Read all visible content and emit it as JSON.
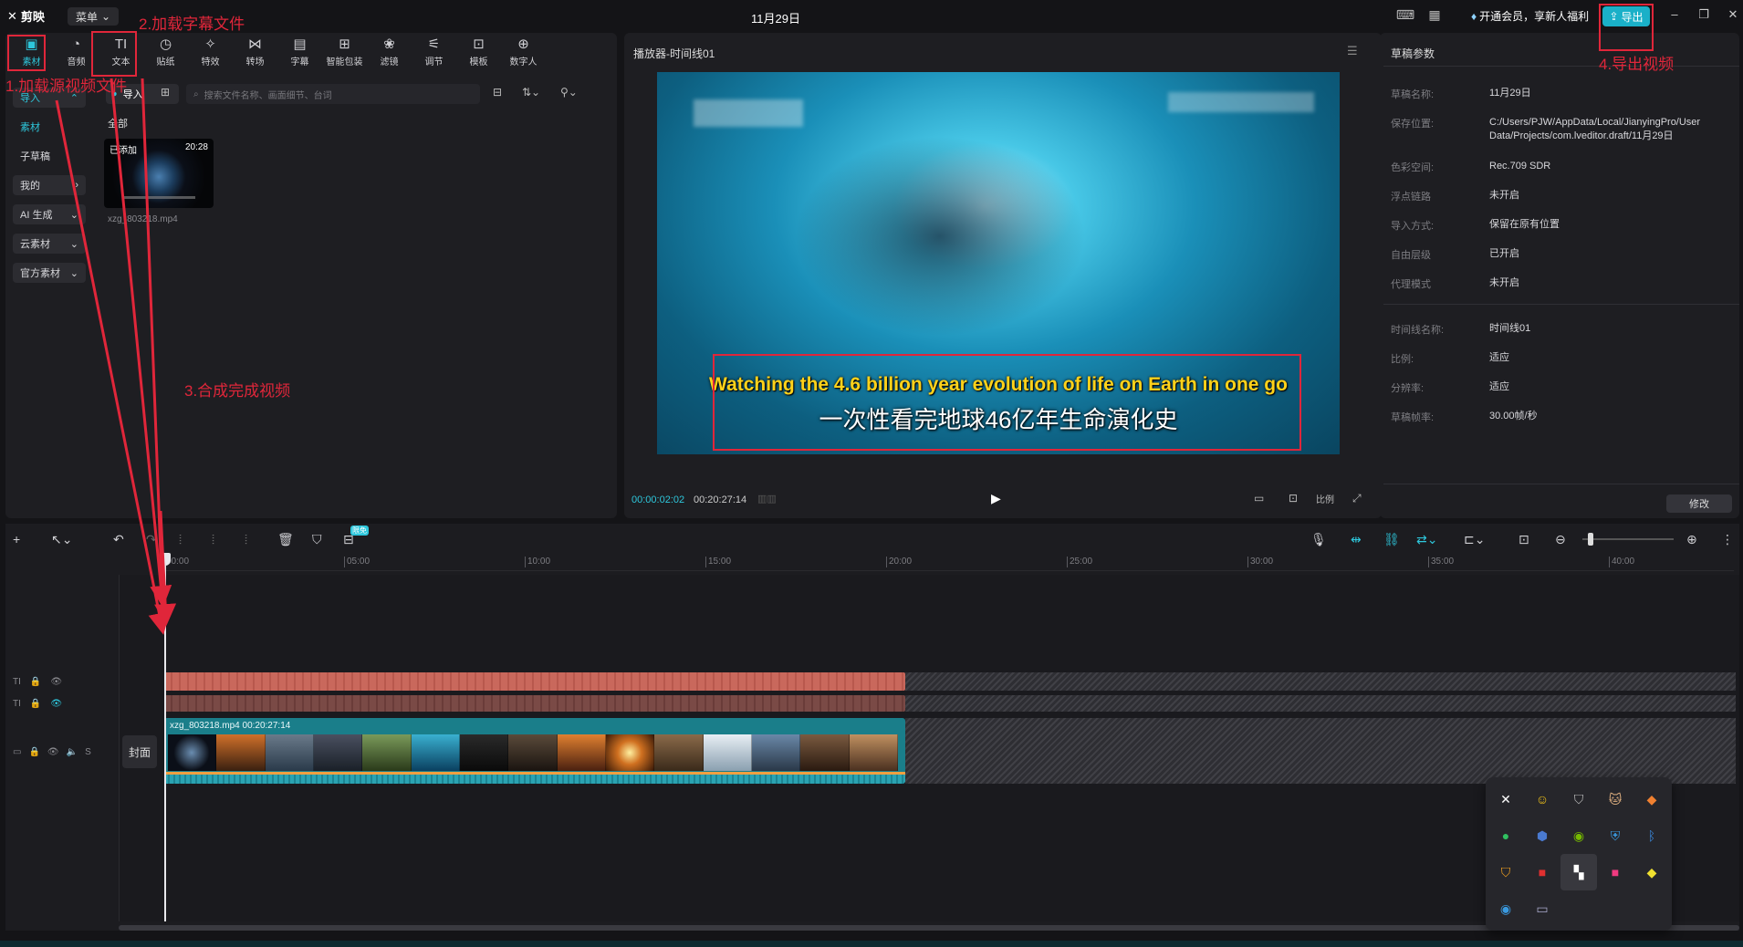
{
  "app": {
    "logo": "剪映",
    "menu": "菜单",
    "project_title": "11月29日",
    "vip_text": "开通会员，享新人福利",
    "export_label": "导出"
  },
  "toolbar": [
    {
      "label": "素材",
      "icon": "media-icon"
    },
    {
      "label": "音频",
      "icon": "audio-icon"
    },
    {
      "label": "文本",
      "icon": "text-icon"
    },
    {
      "label": "贴纸",
      "icon": "sticker-icon"
    },
    {
      "label": "特效",
      "icon": "effects-icon"
    },
    {
      "label": "转场",
      "icon": "transition-icon"
    },
    {
      "label": "字幕",
      "icon": "caption-icon"
    },
    {
      "label": "智能包装",
      "icon": "smart-pack-icon"
    },
    {
      "label": "滤镜",
      "icon": "filter-icon"
    },
    {
      "label": "调节",
      "icon": "adjust-icon"
    },
    {
      "label": "模板",
      "icon": "template-icon"
    },
    {
      "label": "数字人",
      "icon": "avatar-icon"
    }
  ],
  "sidebar": [
    {
      "label": "导入",
      "type": "pill-sel"
    },
    {
      "label": "素材",
      "type": "sel"
    },
    {
      "label": "子草稿",
      "type": "plain"
    },
    {
      "label": "我的",
      "type": "pill"
    },
    {
      "label": "AI 生成",
      "type": "pill"
    },
    {
      "label": "云素材",
      "type": "pill"
    },
    {
      "label": "官方素材",
      "type": "pill"
    }
  ],
  "media": {
    "import_label": "导入",
    "search_placeholder": "搜索文件名称、画面细节、台词",
    "all_label": "全部",
    "thumb_badge": "已添加",
    "thumb_duration": "20:28",
    "thumb_name": "xzg_803218.mp4"
  },
  "player": {
    "title": "播放器-时间线01",
    "subtitle_en": "Watching the 4.6 billion year evolution of life on Earth in one go",
    "subtitle_zh": "一次性看完地球46亿年生命演化史",
    "time_current": "00:00:02:02",
    "time_total": "00:20:27:14",
    "ratio_label": "比例"
  },
  "props": {
    "title": "草稿参数",
    "rows": [
      {
        "label": "草稿名称:",
        "value": "11月29日"
      },
      {
        "label": "保存位置:",
        "value": "C:/Users/PJW/AppData/Local/JianyingPro/User Data/Projects/com.lveditor.draft/11月29日"
      },
      {
        "label": "色彩空间:",
        "value": "Rec.709 SDR"
      },
      {
        "label": "浮点链路",
        "value": "未开启"
      },
      {
        "label": "导入方式:",
        "value": "保留在原有位置"
      },
      {
        "label": "自由层级",
        "value": "已开启"
      },
      {
        "label": "代理模式",
        "value": "未开启"
      }
    ],
    "rows2": [
      {
        "label": "时间线名称:",
        "value": "时间线01"
      },
      {
        "label": "比例:",
        "value": "适应"
      },
      {
        "label": "分辨率:",
        "value": "适应"
      },
      {
        "label": "草稿帧率:",
        "value": "30.00帧/秒"
      }
    ],
    "modify_label": "修改"
  },
  "timeline": {
    "ticks": [
      "00:00",
      "05:00",
      "10:00",
      "15:00",
      "20:00",
      "25:00",
      "30:00",
      "35:00",
      "40:00"
    ],
    "free_badge": "限免",
    "video_clip_label": "xzg_803218.mp4   00:20:27:14",
    "cover_label": "封面"
  },
  "annotations": {
    "a1": "1.加载源视频文件",
    "a2": "2.加载字幕文件",
    "a3": "3.合成完成视频",
    "a4": "4.导出视频"
  },
  "colors": {
    "accent": "#2ec7dc",
    "annotation_red": "#e0263a",
    "subtitle_yellow": "#ffd21a",
    "subtitle_track": "#c9685c",
    "video_track": "#1a7e8a"
  }
}
